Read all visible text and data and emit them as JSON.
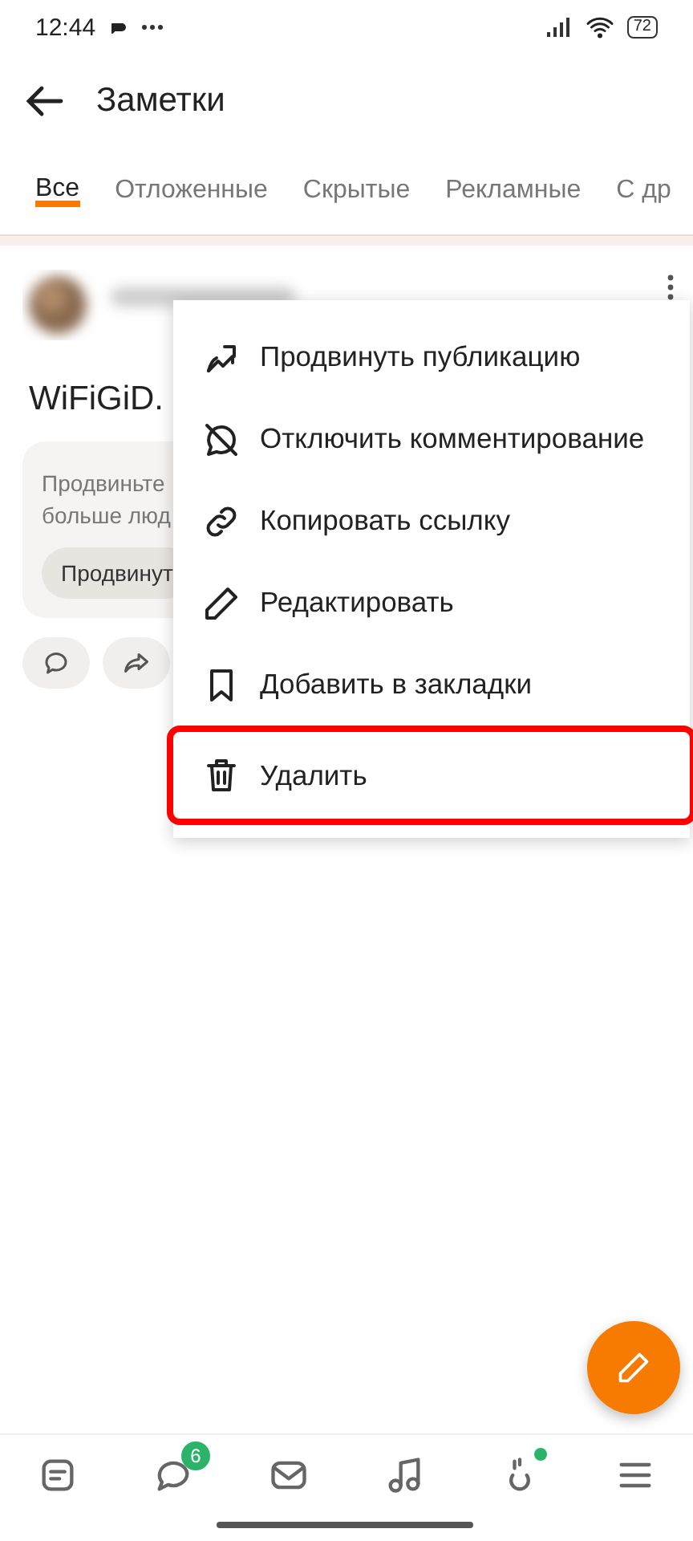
{
  "status_bar": {
    "time": "12:44",
    "battery": "72"
  },
  "header": {
    "title": "Заметки"
  },
  "tabs": [
    {
      "label": "Все",
      "selected": true
    },
    {
      "label": "Отложенные",
      "selected": false
    },
    {
      "label": "Скрытые",
      "selected": false
    },
    {
      "label": "Рекламные",
      "selected": false
    },
    {
      "label": "С др",
      "selected": false
    }
  ],
  "post": {
    "title": "WiFiGiD.",
    "promo_text": [
      "Продвиньте",
      "больше люд"
    ],
    "promo_button": "Продвинут"
  },
  "menu": [
    {
      "kind": "promote",
      "label": "Продвинуть публикацию",
      "highlighted": false
    },
    {
      "kind": "no-comments",
      "label": "Отключить комментирование",
      "highlighted": false
    },
    {
      "kind": "link",
      "label": "Копировать ссылку",
      "highlighted": false
    },
    {
      "kind": "edit",
      "label": "Редактировать",
      "highlighted": false
    },
    {
      "kind": "bookmark",
      "label": "Добавить в закладки",
      "highlighted": false
    },
    {
      "kind": "delete",
      "label": "Удалить",
      "highlighted": true
    }
  ],
  "nav": [
    {
      "kind": "feed",
      "dot": false
    },
    {
      "kind": "chat",
      "badge": "6",
      "dot": false
    },
    {
      "kind": "mail",
      "dot": false
    },
    {
      "kind": "music",
      "dot": false
    },
    {
      "kind": "events",
      "dot": true
    },
    {
      "kind": "menu",
      "dot": false
    }
  ]
}
